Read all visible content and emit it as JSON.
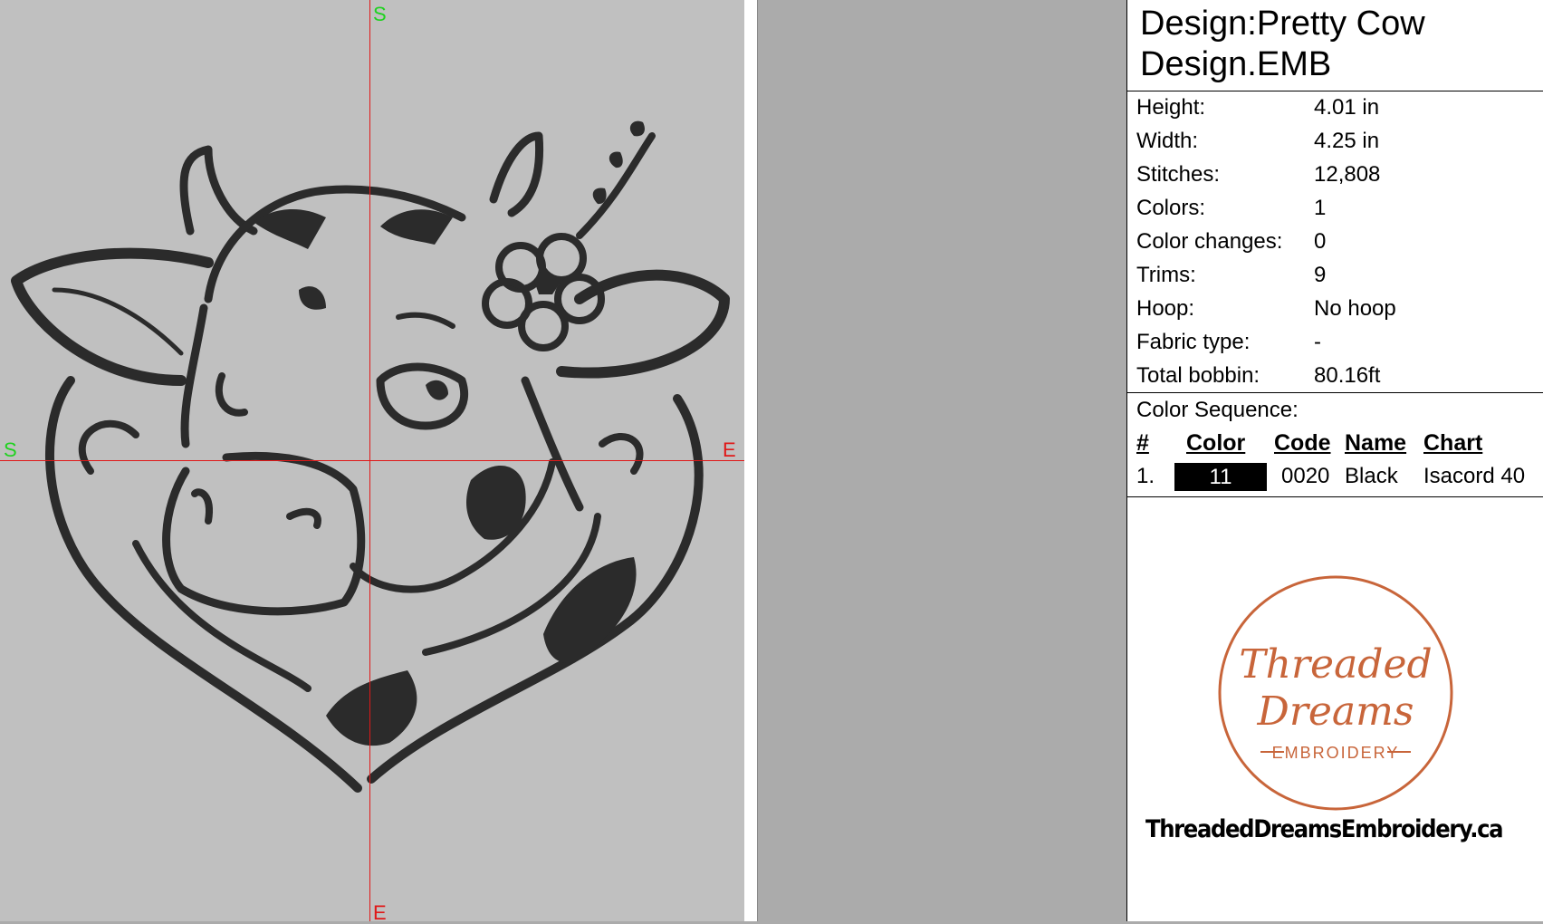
{
  "canvas": {
    "top_label": "S",
    "bottom_label": "E",
    "left_label": "S",
    "right_label": "E",
    "design_image": "cow-head-embroidery"
  },
  "info": {
    "title_line1": "Design:Pretty Cow",
    "title_line2": "Design.EMB",
    "properties": [
      {
        "key": "Height:",
        "value": "4.01 in"
      },
      {
        "key": "Width:",
        "value": "4.25 in"
      },
      {
        "key": "Stitches:",
        "value": "12,808"
      },
      {
        "key": "Colors:",
        "value": "1"
      },
      {
        "key": "Color changes:",
        "value": "0"
      },
      {
        "key": "Trims:",
        "value": "9"
      },
      {
        "key": "Hoop:",
        "value": "No hoop"
      },
      {
        "key": "Fabric type:",
        "value": "-"
      },
      {
        "key": "Total bobbin:",
        "value": "80.16ft"
      }
    ],
    "color_sequence": {
      "title": "Color Sequence:",
      "headers": {
        "num": "#",
        "color": "Color",
        "code": "Code",
        "name": "Name",
        "chart": "Chart"
      },
      "rows": [
        {
          "num": "1.",
          "color_label": "11",
          "swatch": "#000000",
          "code": "0020",
          "name": "Black",
          "chart": "Isacord 40"
        }
      ]
    },
    "logo": {
      "line1": "Threaded",
      "line2": "Dreams",
      "line3": "EMBROIDERY",
      "ring_color": "#c8653a"
    },
    "url": "ThreadedDreamsEmbroidery.ca"
  }
}
